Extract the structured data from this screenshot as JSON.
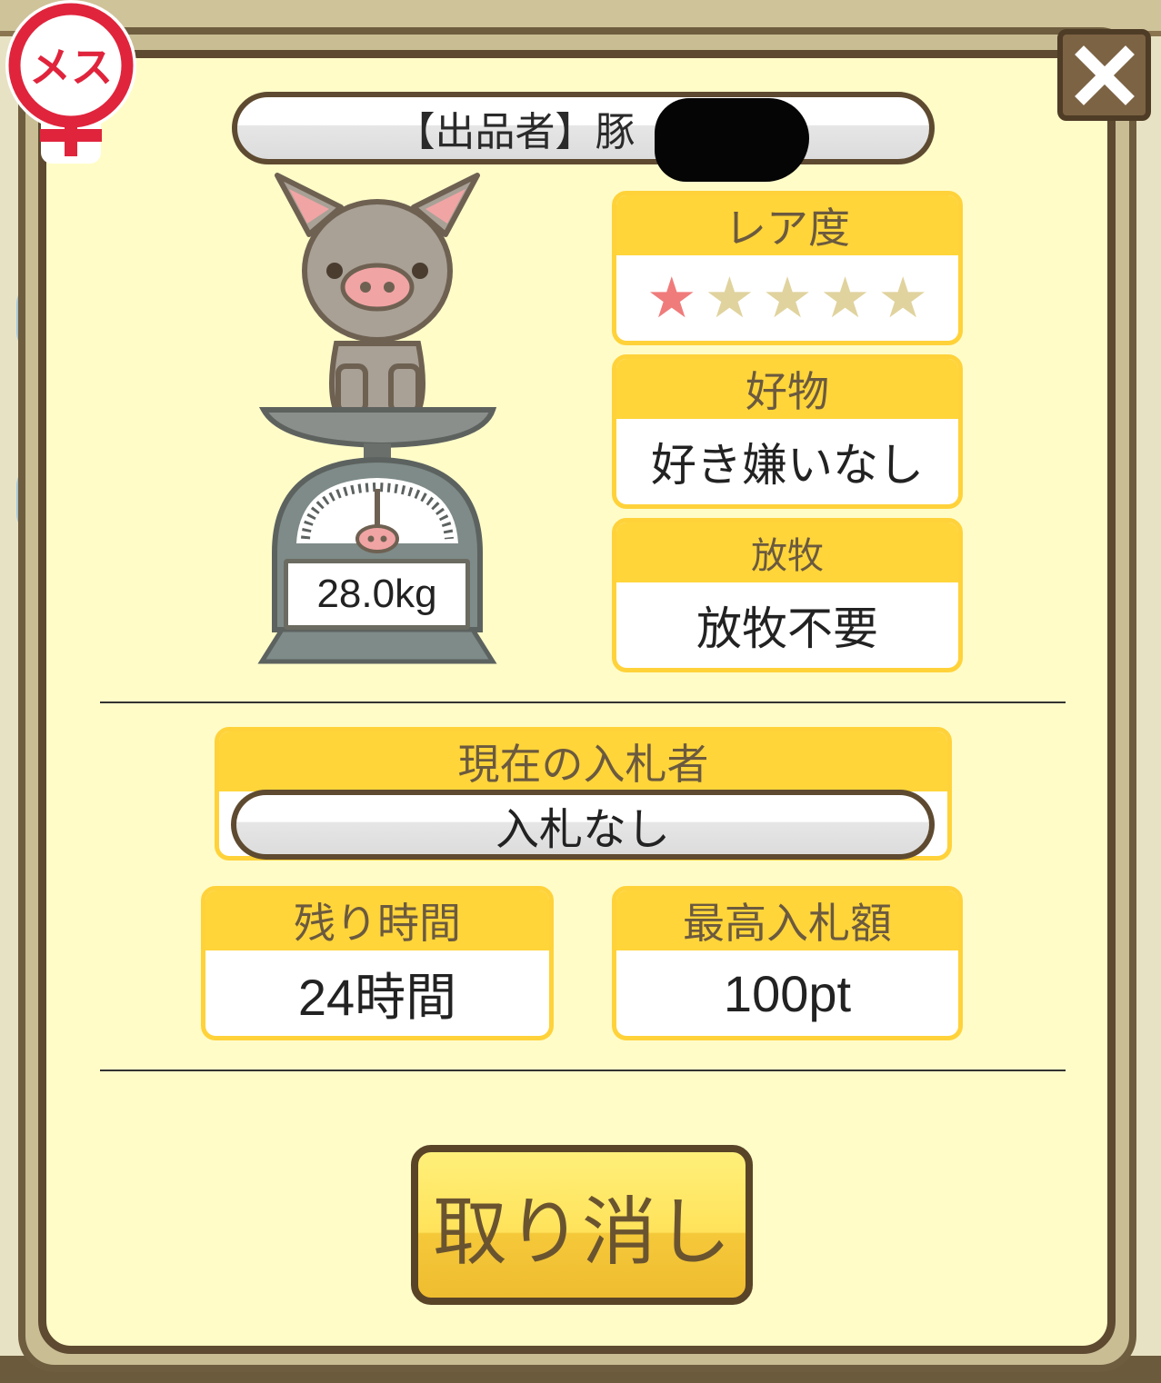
{
  "badge": {
    "gender_label": "メス"
  },
  "seller": {
    "label": "【出品者】豚"
  },
  "pig": {
    "weight": "28.0kg"
  },
  "rarity": {
    "title": "レア度",
    "rating": 1,
    "max": 5,
    "filled_color": "#f07b7b",
    "empty_color": "#e0d39e"
  },
  "favorite": {
    "title": "好物",
    "value": "好き嫌いなし"
  },
  "grazing": {
    "title": "放牧",
    "value": "放牧不要"
  },
  "bidder": {
    "title": "現在の入札者",
    "value": "入札なし"
  },
  "remaining": {
    "title": "残り時間",
    "value": "24時間"
  },
  "highest_bid": {
    "title": "最高入札額",
    "value": "100pt"
  },
  "actions": {
    "cancel_label": "取り消し"
  },
  "icons": {
    "close": "close-icon",
    "female": "female-icon"
  }
}
